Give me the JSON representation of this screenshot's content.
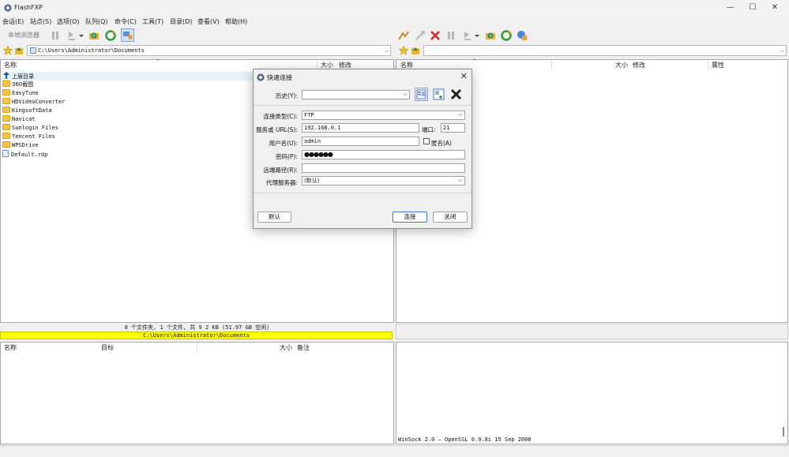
{
  "window": {
    "title": "FlashFXP",
    "controls": {
      "minimize": "—",
      "maximize": "☐",
      "close": "✕"
    }
  },
  "menu": [
    "会话(E)",
    "站点(S)",
    "选项(O)",
    "队列(Q)",
    "命令(C)",
    "工具(T)",
    "目录(D)",
    "查看(V)",
    "帮助(H)"
  ],
  "left_toolbar": {
    "label": "本地浏览器"
  },
  "left_path": "C:\\Users\\Administrator\\Documents",
  "right_path": "",
  "left_panel": {
    "columns": {
      "name": "名称",
      "size": "大小",
      "modified": "修改"
    },
    "items": [
      {
        "name": "上层目录",
        "type": "up"
      },
      {
        "name": "360截图",
        "type": "folder"
      },
      {
        "name": "EasyTune",
        "type": "folder"
      },
      {
        "name": "HDVideoConverter",
        "type": "folder"
      },
      {
        "name": "KingsoftData",
        "type": "folder"
      },
      {
        "name": "Navicat",
        "type": "folder"
      },
      {
        "name": "Sunlogin Files",
        "type": "folder"
      },
      {
        "name": "Tencent Files",
        "type": "folder"
      },
      {
        "name": "WPSDrive",
        "type": "folder"
      },
      {
        "name": "Default.rdp",
        "type": "file"
      }
    ],
    "status": "8 个文件夹, 1 个文件, 共 9 2 KB (51.97 GB 空闲)",
    "path_status": "C:\\Users\\Administrator\\Documents"
  },
  "right_panel": {
    "columns": {
      "name": "名称",
      "size": "大小",
      "modified": "修改",
      "attr": "属性"
    }
  },
  "queue_panel": {
    "columns": {
      "name": "名称",
      "target": "目标",
      "size": "大小",
      "note": "备注"
    }
  },
  "log": {
    "line": "WinSock 2.0 — OpenSSL 0.9.8i 15 Sep 2008"
  },
  "dialog": {
    "title": "快速连接",
    "history_label": "历史(Y):",
    "history_value": "",
    "conn_type_label": "连接类型(C):",
    "conn_type_value": "FTP",
    "server_label": "服务或 URL(S):",
    "server_value": "192.168.0.1",
    "port_label": "端口:",
    "port_value": "21",
    "user_label": "用户名(U):",
    "user_value": "admin",
    "anon_label": "匿名(A)",
    "anon_checked": false,
    "password_label": "密码(P):",
    "password_value": "●●●●●●",
    "remote_path_label": "远端路径(R):",
    "remote_path_value": "",
    "proxy_label": "代理服务器:",
    "proxy_value": "(默认)",
    "default_button": "默认",
    "connect_button": "连接",
    "close_button": "关闭"
  },
  "colors": {
    "path_highlight": "#ffff00",
    "accent": "#3a73c8"
  }
}
